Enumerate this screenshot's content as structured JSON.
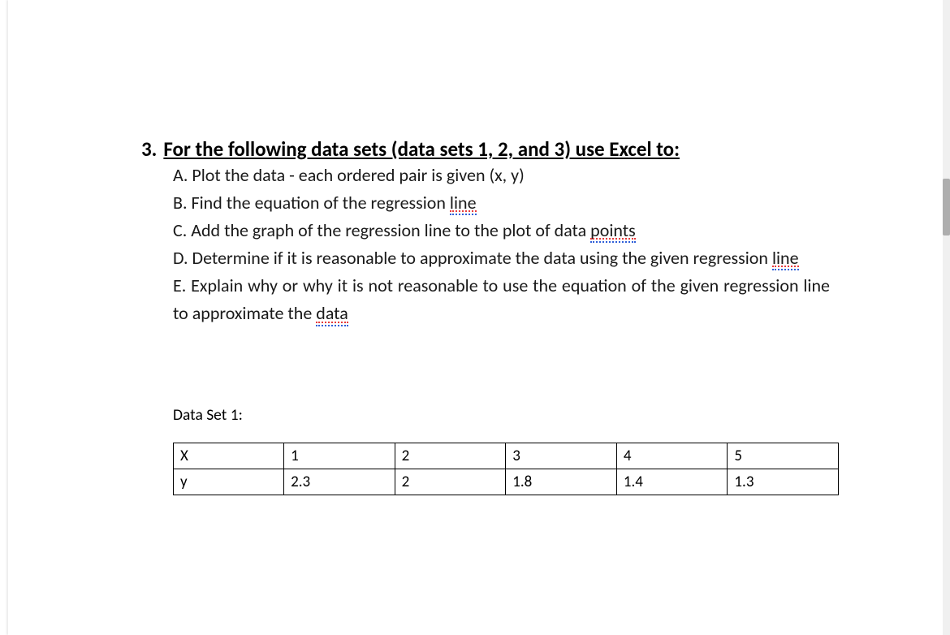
{
  "question": {
    "marker": "3.",
    "title": "For the following data sets (data sets 1, 2, and 3) use Excel to:",
    "items": {
      "a": {
        "text_before": "A. Plot the data - each ordered pair is given (x, y)",
        "underline": "",
        "text_after": ""
      },
      "b": {
        "text_before": "B. Find the equation of the regression ",
        "underline": "line",
        "text_after": ""
      },
      "c": {
        "text_before": "C. Add the graph of the regression line to the plot of data ",
        "underline": "points",
        "text_after": ""
      },
      "d": {
        "text_before": "D. Determine if it is reasonable to approximate the data using the given regression ",
        "underline": "line",
        "text_after": ""
      },
      "e": {
        "text_before": "E. Explain why or why it is not reasonable to use the equation of the given regression line to approximate the ",
        "underline": "data",
        "text_after": ""
      }
    }
  },
  "dataset": {
    "label": "Data Set 1:",
    "rows": [
      {
        "header": "X",
        "c1": "1",
        "c2": "2",
        "c3": "3",
        "c4": "4",
        "c5": "5"
      },
      {
        "header": "y",
        "c1": "2.3",
        "c2": "2",
        "c3": "1.8",
        "c4": "1.4",
        "c5": "1.3"
      }
    ]
  }
}
